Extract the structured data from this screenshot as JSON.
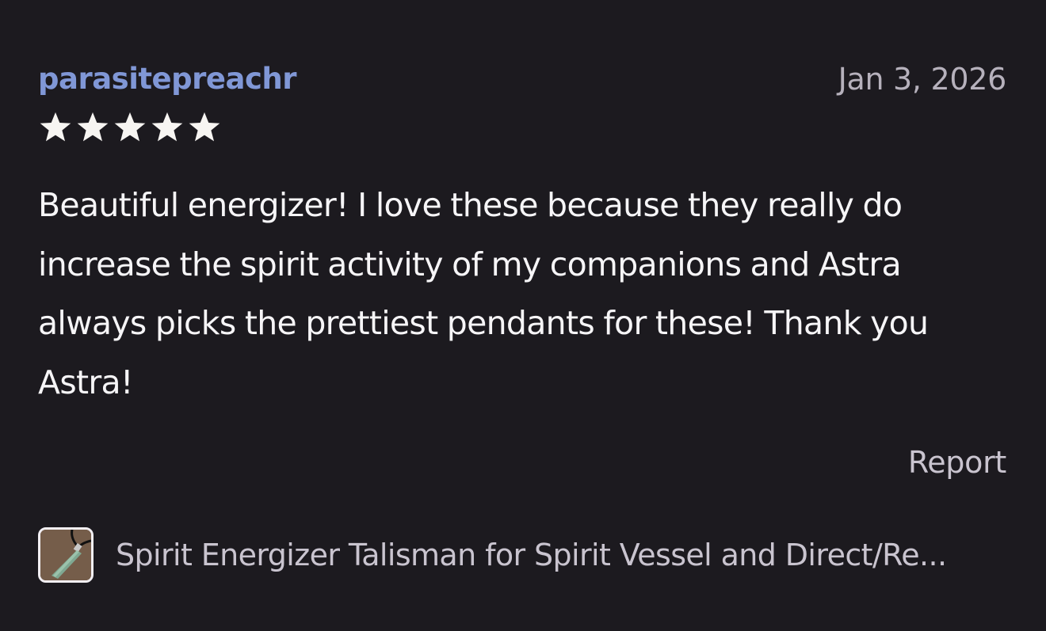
{
  "review": {
    "username": "parasitepreachr",
    "date": "Jan 3, 2026",
    "rating": 5,
    "rating_max": 5,
    "text": "Beautiful energizer! I love these because they really do increase the spirit activity of my companions and Astra always picks the prettiest pendants for these! Thank you Astra!",
    "report_label": "Report"
  },
  "product": {
    "title": "Spirit Energizer Talisman for Spirit Vessel and Direct/Re...",
    "thumbnail_icon": "jade-pendant-thumbnail"
  },
  "colors": {
    "background": "#1c1a1f",
    "username": "#8097d6",
    "star": "#f7f5f2",
    "muted_text": "#c9c4cf"
  }
}
